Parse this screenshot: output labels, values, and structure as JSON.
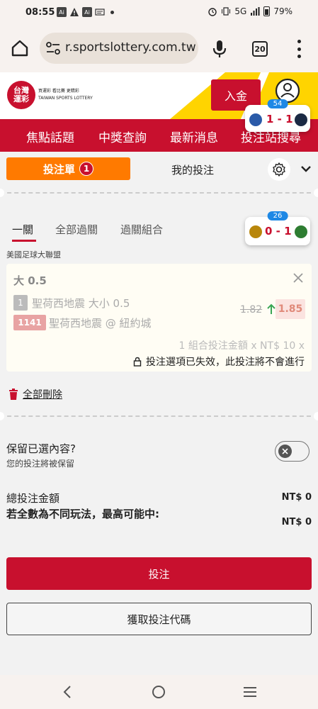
{
  "status_bar": {
    "time": "08:55",
    "notification_icons": [
      "ai-icon",
      "warning-icon",
      "ai-icon",
      "news-icon"
    ],
    "network": "5G",
    "battery": "79%"
  },
  "browser": {
    "url": "r.sportslottery.com.tw",
    "tab_count": "20"
  },
  "site_header": {
    "logo_text": "台灣\n運彩",
    "logo_tagline_1": "買運彩  看比賽  更精彩",
    "logo_tagline_2": "TAIWAN SPORTS LOTTERY",
    "deposit_label": "入金"
  },
  "nav": {
    "items": [
      "焦點話題",
      "中獎查詢",
      "最新消息",
      "投注站搜尋"
    ]
  },
  "score_widget_top": {
    "badge": "54",
    "score": "1 - 1"
  },
  "score_widget_mid": {
    "badge": "26",
    "score": "0 - 1"
  },
  "slip": {
    "tab_active_label": "投注單",
    "tab_active_count": "1",
    "tab_other_label": "我的投注"
  },
  "bet_types": {
    "tabs": [
      "一關",
      "全部過關",
      "過關組合"
    ],
    "league": "美國足球大聯盟"
  },
  "bet_card": {
    "title": "大 0.5",
    "selection_number": "1",
    "selection_text": "聖荷西地震 大小 0.5",
    "odds_old": "1.82",
    "odds_new": "1.85",
    "match_number": "1141",
    "match_text": "聖荷西地震 @ 紐約城",
    "combo_text": "1 組合投注金額 x NT$ 10 x",
    "invalid_note": "投注選項已失效，此投注將不會進行"
  },
  "delete_all_label": "全部刪除",
  "keep": {
    "title": "保留已選內容?",
    "subtitle": "您的投注將被保留"
  },
  "totals": {
    "total_label": "總投注金額",
    "total_value": "NT$ 0",
    "max_label": "若全數為不同玩法，最高可能中:",
    "max_value": "NT$ 0"
  },
  "buttons": {
    "place_bet": "投注",
    "get_code": "獲取投注代碼"
  },
  "colors": {
    "brand_red": "#c8102e",
    "accent_orange": "#ff7a00",
    "header_yellow": "#ffd400",
    "badge_blue": "#1e88e5"
  }
}
